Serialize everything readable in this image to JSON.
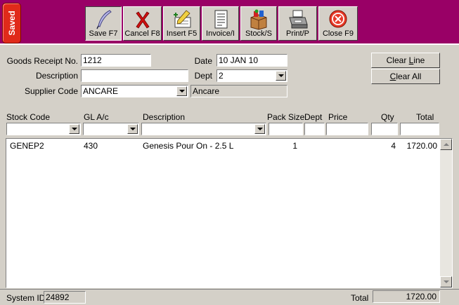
{
  "toolbar": {
    "saved_label": "Saved",
    "buttons": [
      {
        "label": "Save F7",
        "icon": "quill-pen-icon"
      },
      {
        "label": "Cancel F8",
        "icon": "red-x-icon"
      },
      {
        "label": "Insert F5",
        "icon": "insert-pencil-icon"
      },
      {
        "label": "Invoice/I",
        "icon": "invoice-document-icon"
      },
      {
        "label": "Stock/S",
        "icon": "stock-box-icon"
      },
      {
        "label": "Print/P",
        "icon": "printer-icon"
      },
      {
        "label": "Close F9",
        "icon": "close-circle-icon"
      }
    ]
  },
  "form": {
    "goods_receipt_label": "Goods Receipt No.",
    "goods_receipt_value": "1212",
    "description_label": "Description",
    "description_value": "",
    "supplier_label": "Supplier Code",
    "supplier_value": "ANCARE",
    "supplier_name": "Ancare",
    "date_label": "Date",
    "date_value": "10 JAN 10",
    "dept_label": "Dept",
    "dept_value": "2"
  },
  "actions": {
    "clear_line_pre": "Clear ",
    "clear_line_key": "L",
    "clear_line_post": "ine",
    "clear_all_pre": "",
    "clear_all_key": "C",
    "clear_all_post": "lear All"
  },
  "grid": {
    "headers": {
      "stock_code": "Stock Code",
      "gl_ac": "GL A/c",
      "description": "Description",
      "pack_size": "Pack Size",
      "dept": "Dept",
      "price": "Price",
      "qty": "Qty",
      "total": "Total"
    },
    "rows": [
      {
        "stock_code": "GENEP2",
        "gl_ac": "430",
        "description": "Genesis Pour On - 2.5 L",
        "pack_size": "1",
        "dept": "",
        "price": "",
        "qty": "4",
        "total": "1720.00"
      }
    ]
  },
  "footer": {
    "system_id_label": "System ID",
    "system_id_value": "24892",
    "total_label": "Total",
    "total_value": "1720.00"
  }
}
